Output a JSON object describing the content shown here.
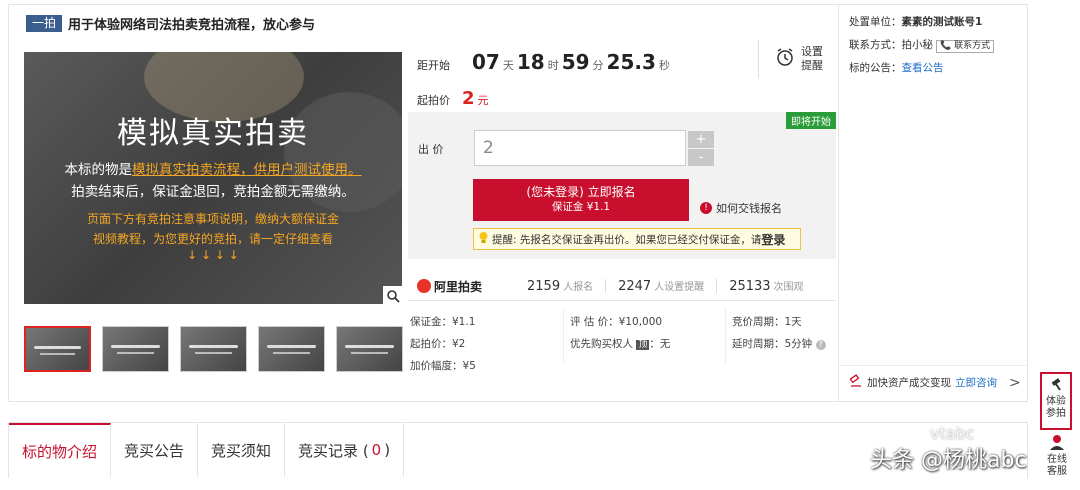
{
  "header": {
    "tag": "一拍",
    "title": "用于体验网络司法拍卖竞拍流程，放心参与"
  },
  "hero": {
    "heading": "模拟真实拍卖",
    "line1_prefix": "本标的物是",
    "line1_highlight": "模拟真实拍卖流程，供用户测试使用。",
    "line2": "拍卖结束后，保证金退回，竞拍金额无需缴纳。",
    "line3": "页面下方有竞拍注意事项说明，缴纳大额保证金",
    "line4": "视频教程，为您更好的竞拍，请一定仔细查看",
    "line5": "↓ ↓ ↓ ↓"
  },
  "countdown": {
    "label": "距开始",
    "days": "07",
    "days_unit": "天",
    "hours": "18",
    "hours_unit": "时",
    "minutes": "59",
    "minutes_unit": "分",
    "seconds": "25.3",
    "seconds_unit": "秒"
  },
  "remind": {
    "line1": "设置",
    "line2": "提醒"
  },
  "start_price": {
    "label": "起拍价",
    "value": "2",
    "unit": "元"
  },
  "bid": {
    "soon_badge": "即将开始",
    "label": "出  价",
    "input_value": "2",
    "plus": "+",
    "minus": "-",
    "signup_line1": "(您未登录) 立即报名",
    "signup_line2": "保证金 ¥1.1",
    "howpay_icon": "!",
    "howpay_label": "如何交钱报名",
    "tip_text": "提醒: 先报名交保证金再出价。如果您已经交付保证金，请",
    "tip_login": "登录"
  },
  "stats": {
    "brand": "阿里拍卖",
    "signups": "2159",
    "signups_unit": "人报名",
    "reminders": "2247",
    "reminders_unit": "人设置提醒",
    "views": "25133",
    "views_unit": "次围观"
  },
  "info": {
    "deposit": "保证金：¥1.1",
    "start": "起拍价：¥2",
    "increment": "加价幅度：¥5",
    "estimate": "评 估 价：¥10,000",
    "priority_prefix": "优先购买权人",
    "priority_badge": "顶",
    "priority_suffix": "：无",
    "period": "竞价周期：1天",
    "delay": "延时周期：5分钟",
    "help_icon": "?"
  },
  "right": {
    "unit_label": "处置单位：",
    "unit_value": "素素的测试账号1",
    "contact_label": "联系方式：拍小秘",
    "contact_btn": "📞 联系方式",
    "notice_label": "标的公告：",
    "notice_link": "查看公告",
    "bottom_text": "加快资产成交变现",
    "bottom_link": "立即咨询",
    "arrow": ">"
  },
  "tabs": [
    {
      "label": "标的物介绍"
    },
    {
      "label": "竞买公告"
    },
    {
      "label": "竞买须知"
    },
    {
      "label": "竞买记录 (",
      "count": "0",
      "suffix": ")"
    }
  ],
  "float": {
    "experience_1": "体验",
    "experience_2": "参拍",
    "service_1": "在线",
    "service_2": "客服"
  },
  "watermark": {
    "main": "头条 @杨桃abc",
    "sub": "vtabc"
  },
  "colors": {
    "accent": "#c8102e",
    "link": "#1e6fc8",
    "highlight": "#f5a623",
    "badge": "#2a9d3a"
  }
}
